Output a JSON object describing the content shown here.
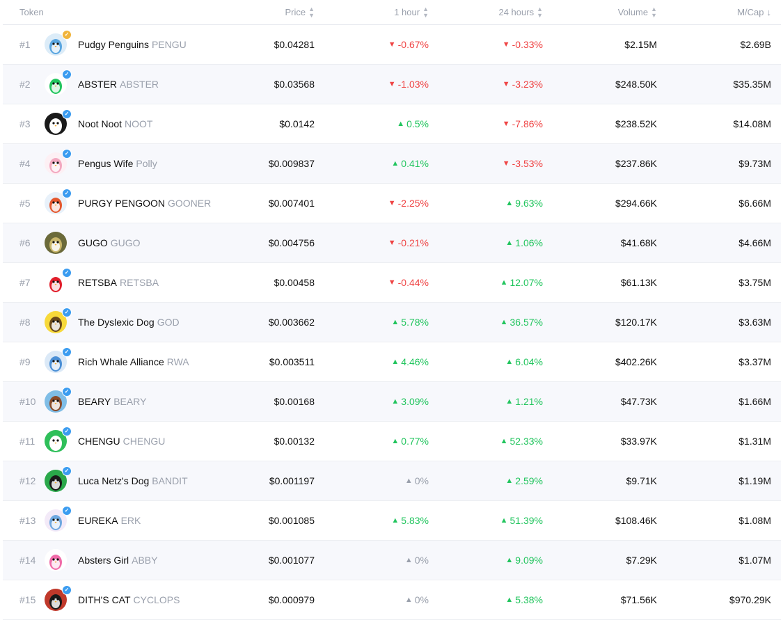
{
  "headers": {
    "token": "Token",
    "price": "Price",
    "h1": "1 hour",
    "h24": "24 hours",
    "volume": "Volume",
    "mcap": "M/Cap"
  },
  "colors": {
    "up": "#22c55e",
    "down": "#ef4444",
    "flat": "#9aa0ac",
    "verified_badge": "#3b9cf0",
    "gold_badge": "#f0b43c"
  },
  "tokens": [
    {
      "rank": "#1",
      "name": "Pudgy Penguins",
      "symbol": "PENGU",
      "price": "$0.04281",
      "h1": "-0.67%",
      "h1_dir": "down",
      "h24": "-0.33%",
      "h24_dir": "down",
      "volume": "$2.15M",
      "mcap": "$2.69B",
      "avatar_bg": "#dcecf8",
      "avatar_fg": "#5aa6e0",
      "badge": "gold"
    },
    {
      "rank": "#2",
      "name": "ABSTER",
      "symbol": "ABSTER",
      "price": "$0.03568",
      "h1": "-1.03%",
      "h1_dir": "down",
      "h24": "-3.23%",
      "h24_dir": "down",
      "volume": "$248.50K",
      "mcap": "$35.35M",
      "avatar_bg": "#ffffff",
      "avatar_fg": "#22c55e",
      "badge": "blue"
    },
    {
      "rank": "#3",
      "name": "Noot Noot",
      "symbol": "NOOT",
      "price": "$0.0142",
      "h1": "0.5%",
      "h1_dir": "up",
      "h24": "-7.86%",
      "h24_dir": "down",
      "volume": "$238.52K",
      "mcap": "$14.08M",
      "avatar_bg": "#1a1a1a",
      "avatar_fg": "#ffffff",
      "badge": "blue"
    },
    {
      "rank": "#4",
      "name": "Pengus Wife",
      "symbol": "Polly",
      "price": "$0.009837",
      "h1": "0.41%",
      "h1_dir": "up",
      "h24": "-3.53%",
      "h24_dir": "down",
      "volume": "$237.86K",
      "mcap": "$9.73M",
      "avatar_bg": "#fdf0f4",
      "avatar_fg": "#f3a8c0",
      "badge": "blue"
    },
    {
      "rank": "#5",
      "name": "PURGY PENGOON",
      "symbol": "GOONER",
      "price": "$0.007401",
      "h1": "-2.25%",
      "h1_dir": "down",
      "h24": "9.63%",
      "h24_dir": "up",
      "volume": "$294.66K",
      "mcap": "$6.66M",
      "avatar_bg": "#e8f1fa",
      "avatar_fg": "#e4572e",
      "badge": "blue"
    },
    {
      "rank": "#6",
      "name": "GUGO",
      "symbol": "GUGO",
      "price": "$0.004756",
      "h1": "-0.21%",
      "h1_dir": "down",
      "h24": "1.06%",
      "h24_dir": "up",
      "volume": "$41.68K",
      "mcap": "$4.66M",
      "avatar_bg": "#6b6a3a",
      "avatar_fg": "#c9b66a",
      "badge": "none"
    },
    {
      "rank": "#7",
      "name": "RETSBA",
      "symbol": "RETSBA",
      "price": "$0.00458",
      "h1": "-0.44%",
      "h1_dir": "down",
      "h24": "12.07%",
      "h24_dir": "up",
      "volume": "$61.13K",
      "mcap": "$3.75M",
      "avatar_bg": "#ffffff",
      "avatar_fg": "#e11d2a",
      "badge": "blue"
    },
    {
      "rank": "#8",
      "name": "The Dyslexic Dog",
      "symbol": "GOD",
      "price": "$0.003662",
      "h1": "5.78%",
      "h1_dir": "up",
      "h24": "36.57%",
      "h24_dir": "up",
      "volume": "$120.17K",
      "mcap": "$3.63M",
      "avatar_bg": "#f7d93a",
      "avatar_fg": "#6b4a1a",
      "badge": "blue"
    },
    {
      "rank": "#9",
      "name": "Rich Whale Alliance",
      "symbol": "RWA",
      "price": "$0.003511",
      "h1": "4.46%",
      "h1_dir": "up",
      "h24": "6.04%",
      "h24_dir": "up",
      "volume": "$402.26K",
      "mcap": "$3.37M",
      "avatar_bg": "#dbe9f7",
      "avatar_fg": "#4a8fd6",
      "badge": "blue"
    },
    {
      "rank": "#10",
      "name": "BEARY",
      "symbol": "BEARY",
      "price": "$0.00168",
      "h1": "3.09%",
      "h1_dir": "up",
      "h24": "1.21%",
      "h24_dir": "up",
      "volume": "$47.73K",
      "mcap": "$1.66M",
      "avatar_bg": "#7fbde6",
      "avatar_fg": "#8a4b2a",
      "badge": "blue"
    },
    {
      "rank": "#11",
      "name": "CHENGU",
      "symbol": "CHENGU",
      "price": "$0.00132",
      "h1": "0.77%",
      "h1_dir": "up",
      "h24": "52.33%",
      "h24_dir": "up",
      "volume": "$33.97K",
      "mcap": "$1.31M",
      "avatar_bg": "#2fbf5a",
      "avatar_fg": "#ffffff",
      "badge": "blue"
    },
    {
      "rank": "#12",
      "name": "Luca Netz's Dog",
      "symbol": "BANDIT",
      "price": "$0.001197",
      "h1": "0%",
      "h1_dir": "flat",
      "h24": "2.59%",
      "h24_dir": "up",
      "volume": "$9.71K",
      "mcap": "$1.19M",
      "avatar_bg": "#2aa84a",
      "avatar_fg": "#1a1a1a",
      "badge": "blue"
    },
    {
      "rank": "#13",
      "name": "EUREKA",
      "symbol": "ERK",
      "price": "$0.001085",
      "h1": "5.83%",
      "h1_dir": "up",
      "h24": "51.39%",
      "h24_dir": "up",
      "volume": "$108.46K",
      "mcap": "$1.08M",
      "avatar_bg": "#f3eaf8",
      "avatar_fg": "#6fa8e0",
      "badge": "blue"
    },
    {
      "rank": "#14",
      "name": "Absters Girl",
      "symbol": "ABBY",
      "price": "$0.001077",
      "h1": "0%",
      "h1_dir": "flat",
      "h24": "9.09%",
      "h24_dir": "up",
      "volume": "$7.29K",
      "mcap": "$1.07M",
      "avatar_bg": "#ffffff",
      "avatar_fg": "#f06ba8",
      "badge": "none"
    },
    {
      "rank": "#15",
      "name": "DITH'S CAT",
      "symbol": "CYCLOPS",
      "price": "$0.000979",
      "h1": "0%",
      "h1_dir": "flat",
      "h24": "5.38%",
      "h24_dir": "up",
      "volume": "$71.56K",
      "mcap": "$970.29K",
      "avatar_bg": "#c0392b",
      "avatar_fg": "#1a1a1a",
      "badge": "blue"
    }
  ]
}
